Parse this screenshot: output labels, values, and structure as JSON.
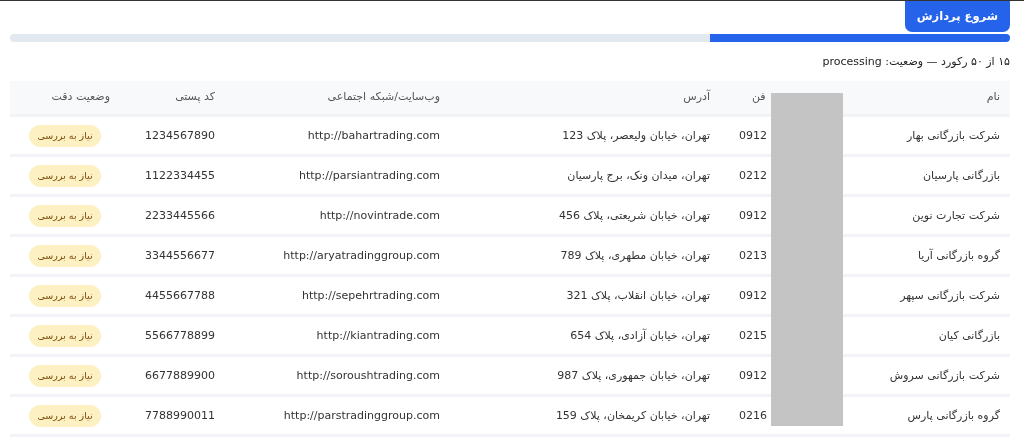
{
  "start_button": {
    "label": "شروع پردازش"
  },
  "progress": {
    "level": 0.3
  },
  "status_line": "۱۵ از ۵۰ رکورد — وضعیت: processing",
  "table": {
    "columns": [
      "نام",
      "فن",
      "آدرس",
      "وب‌سایت/شبکه اجتماعی",
      "کد پستی",
      "وضعیت دقت"
    ],
    "rows": [
      {
        "name": "شرکت بازرگانی بهار",
        "phone": "0912",
        "address": "تهران، خیابان ولیعصر، پلاک 123",
        "website": "http://bahartrading.com",
        "postcode": "1234567890",
        "status": "نیاز به بررسی"
      },
      {
        "name": "بازرگانی پارسیان",
        "phone": "0212",
        "address": "تهران، میدان ونک، برج پارسیان",
        "website": "http://parsiantrading.com",
        "postcode": "1122334455",
        "status": "نیاز به بررسی"
      },
      {
        "name": "شرکت تجارت نوین",
        "phone": "0912",
        "address": "تهران، خیابان شریعتی، پلاک 456",
        "website": "http://novintrade.com",
        "postcode": "2233445566",
        "status": "نیاز به بررسی"
      },
      {
        "name": "گروه بازرگانی آریا",
        "phone": "0213",
        "address": "تهران، خیابان مطهری، پلاک 789",
        "website": "http://aryatradinggroup.com",
        "postcode": "3344556677",
        "status": "نیاز به بررسی"
      },
      {
        "name": "شرکت بازرگانی سپهر",
        "phone": "0912",
        "address": "تهران، خیابان انقلاب، پلاک 321",
        "website": "http://sepehrtrading.com",
        "postcode": "4455667788",
        "status": "نیاز به بررسی"
      },
      {
        "name": "بازرگانی کیان",
        "phone": "0215",
        "address": "تهران، خیابان آزادی، پلاک 654",
        "website": "http://kiantrading.com",
        "postcode": "5566778899",
        "status": "نیاز به بررسی"
      },
      {
        "name": "شرکت بازرگانی سروش",
        "phone": "0912",
        "address": "تهران، خیابان جمهوری، پلاک 987",
        "website": "http://soroushtrading.com",
        "postcode": "6677889900",
        "status": "نیاز به بررسی"
      },
      {
        "name": "گروه بازرگانی پارس",
        "phone": "0216",
        "address": "تهران، خیابان کریمخان، پلاک 159",
        "website": "http://parstradinggroup.com",
        "postcode": "7788990011",
        "status": "نیاز به بررسی"
      }
    ]
  }
}
